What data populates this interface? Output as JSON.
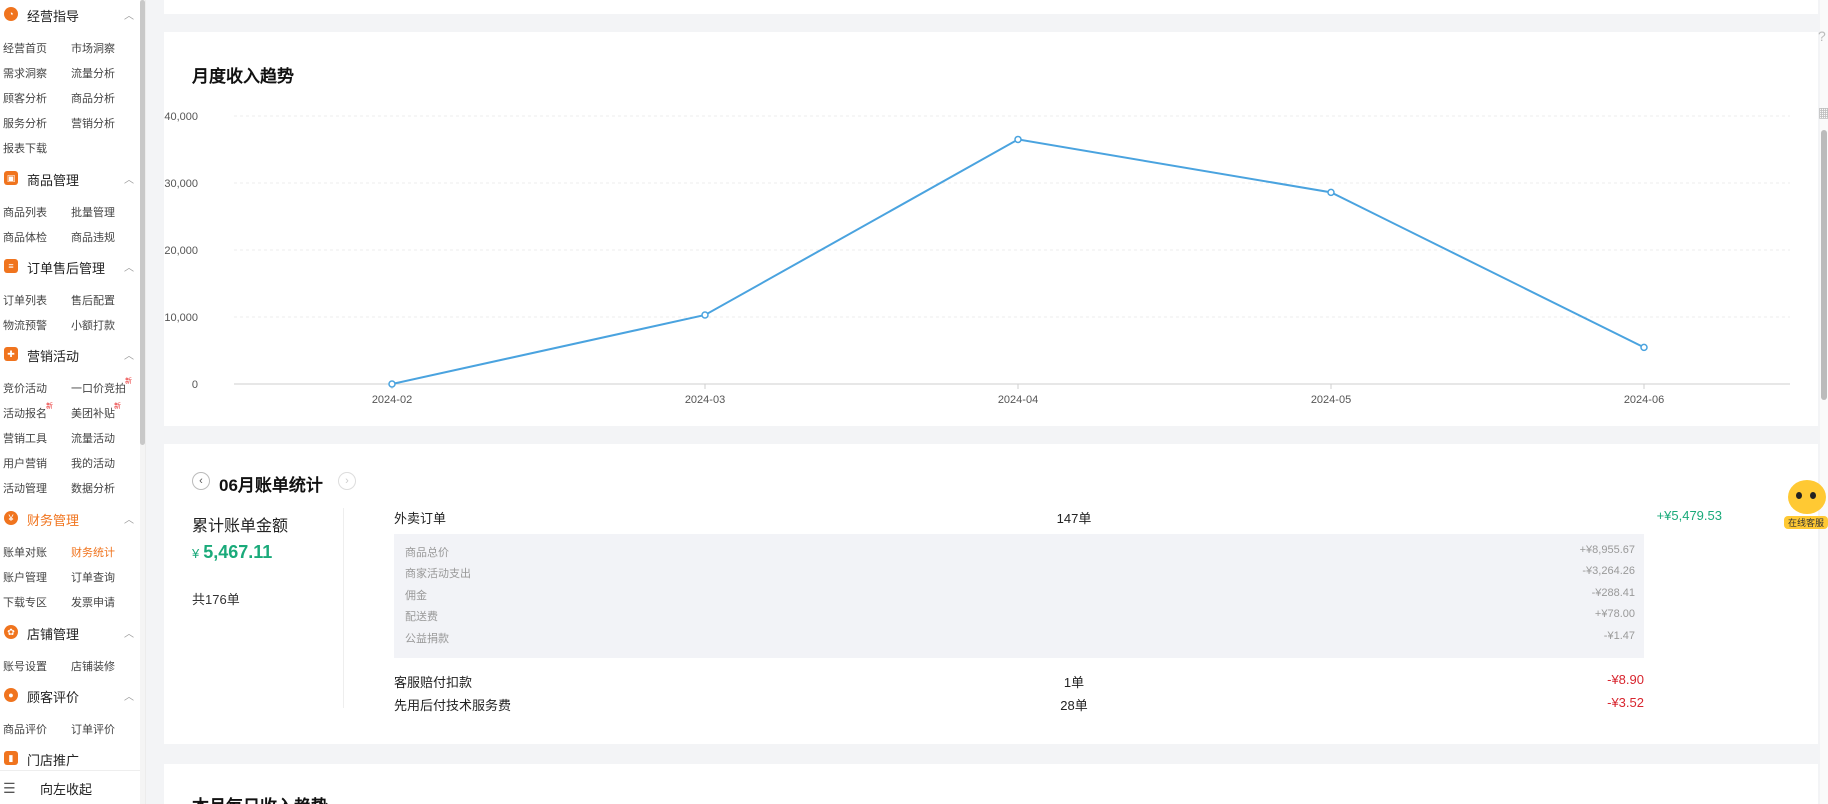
{
  "sidebar": {
    "sections": [
      {
        "title": "经营指导",
        "items": [
          "经营首页",
          "市场洞察",
          "需求洞察",
          "流量分析",
          "顾客分析",
          "商品分析",
          "服务分析",
          "营销分析",
          "报表下载"
        ]
      },
      {
        "title": "商品管理",
        "items": [
          "商品列表",
          "批量管理",
          "商品体检",
          "商品违规"
        ]
      },
      {
        "title": "订单售后管理",
        "items": [
          "订单列表",
          "售后配置",
          "物流预警",
          "小额打款"
        ]
      },
      {
        "title": "营销活动",
        "items": [
          "竞价活动",
          "一口价竞拍",
          "活动报名",
          "美团补贴",
          "营销工具",
          "流量活动",
          "用户营销",
          "我的活动",
          "活动管理",
          "数据分析"
        ]
      },
      {
        "title": "财务管理",
        "items": [
          "账单对账",
          "财务统计",
          "账户管理",
          "订单查询",
          "下载专区",
          "发票申请"
        ]
      },
      {
        "title": "店铺管理",
        "items": [
          "账号设置",
          "店铺装修"
        ]
      },
      {
        "title": "顾客评价",
        "items": [
          "商品评价",
          "订单评价"
        ]
      },
      {
        "title": "门店推广",
        "items": []
      }
    ],
    "new_badge": "新",
    "collapse_label": "向左收起"
  },
  "monthly_chart": {
    "title": "月度收入趋势"
  },
  "chart_data": {
    "type": "line",
    "title": "月度收入趋势",
    "categories": [
      "2024-02",
      "2024-03",
      "2024-04",
      "2024-05",
      "2024-06"
    ],
    "values": [
      0,
      10300,
      36500,
      28600,
      5467
    ],
    "y_ticks": [
      "0",
      "10,000",
      "20,000",
      "30,000",
      "40,000"
    ],
    "ylim": [
      0,
      40000
    ],
    "grid": true,
    "color": "#4aa3df"
  },
  "bill": {
    "title": "06月账单统计",
    "prev_icon": "‹",
    "next_icon": "›",
    "total_label": "累计账单金额",
    "currency": "¥",
    "total_amount": "5,467.11",
    "total_count": "共176单",
    "rows": {
      "takeout": {
        "name": "外卖订单",
        "count": "147单",
        "amount": "+¥5,479.53"
      },
      "compensation": {
        "name": "客服赔付扣款",
        "count": "1单",
        "amount": "-¥8.90"
      },
      "tech_fee": {
        "name": "先用后付技术服务费",
        "count": "28单",
        "amount": "-¥3.52"
      }
    },
    "details": [
      {
        "name": "商品总价",
        "amount": "+¥8,955.67"
      },
      {
        "name": "商家活动支出",
        "amount": "-¥3,264.26"
      },
      {
        "name": "佣金",
        "amount": "-¥288.41"
      },
      {
        "name": "配送费",
        "amount": "+¥78.00"
      },
      {
        "name": "公益捐款",
        "amount": "-¥1.47"
      }
    ]
  },
  "daily_chart": {
    "title": "本月每日收入趋势"
  },
  "service": {
    "label": "在线客服"
  }
}
